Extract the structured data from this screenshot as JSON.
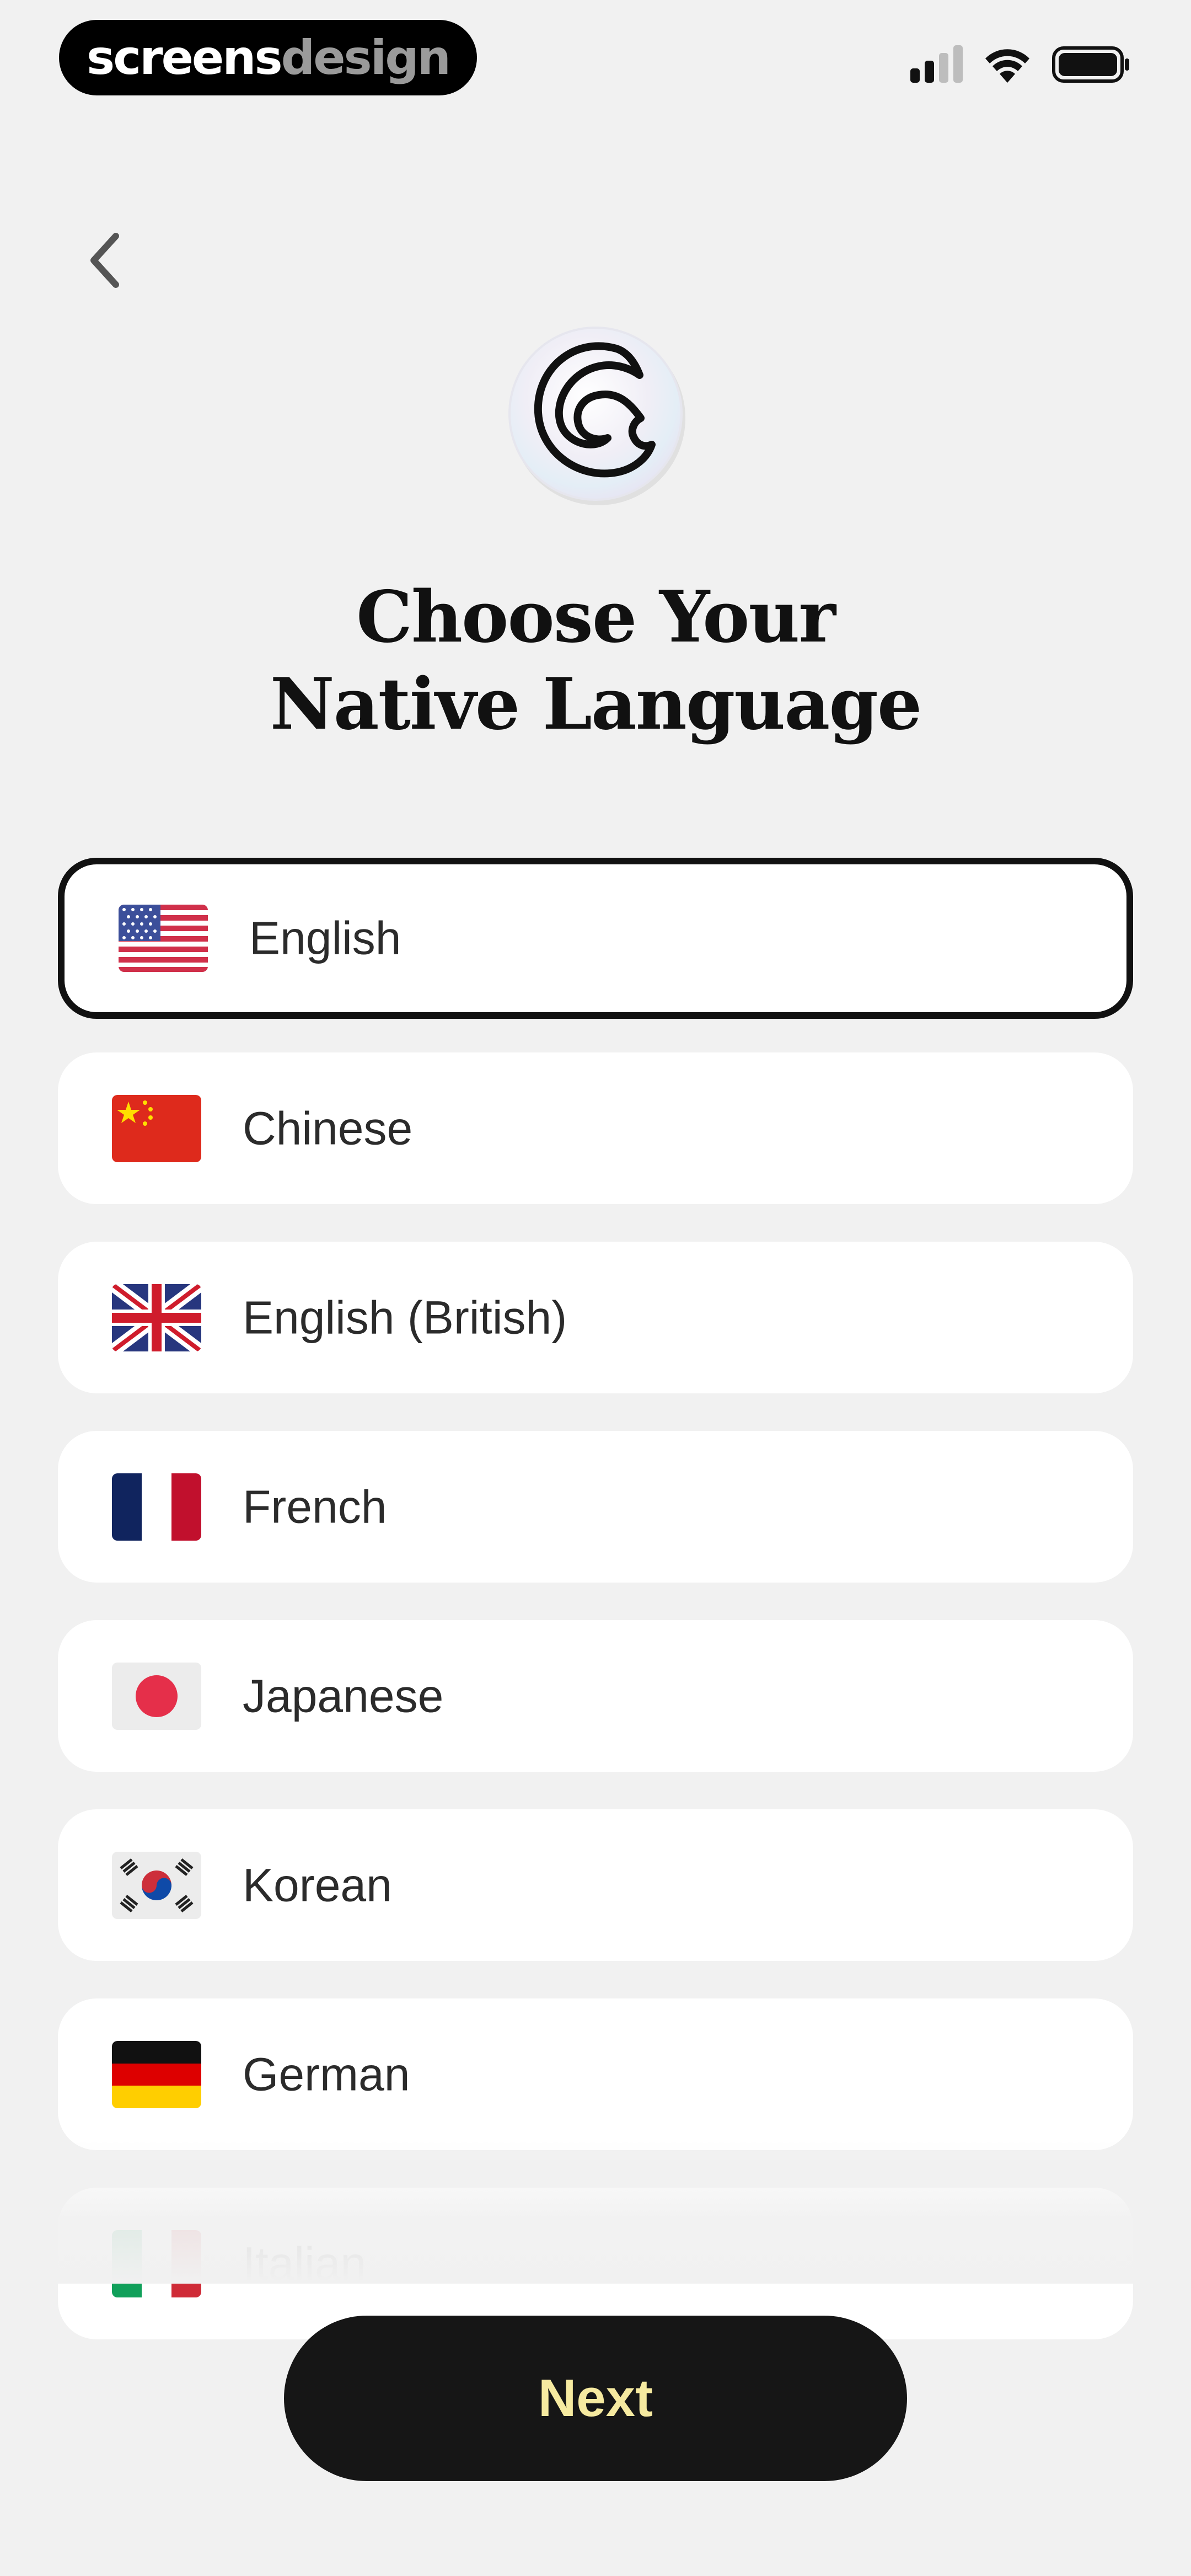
{
  "status_bar": {
    "brand_part1": "screens",
    "brand_part2": "design"
  },
  "header": {
    "back_icon": "chevron-left-icon",
    "logo_icon": "wave-logo-icon",
    "title_line1": "Choose Your",
    "title_line2": "Native Language"
  },
  "languages": [
    {
      "label": "English",
      "flag": "flag-us-icon",
      "selected": true
    },
    {
      "label": "Chinese",
      "flag": "flag-cn-icon",
      "selected": false
    },
    {
      "label": "English (British)",
      "flag": "flag-gb-icon",
      "selected": false
    },
    {
      "label": "French",
      "flag": "flag-fr-icon",
      "selected": false
    },
    {
      "label": "Japanese",
      "flag": "flag-jp-icon",
      "selected": false
    },
    {
      "label": "Korean",
      "flag": "flag-kr-icon",
      "selected": false
    },
    {
      "label": "German",
      "flag": "flag-de-icon",
      "selected": false
    },
    {
      "label": "Italian",
      "flag": "flag-it-icon",
      "selected": false
    }
  ],
  "footer": {
    "next_label": "Next"
  },
  "colors": {
    "background": "#f1f1f1",
    "card": "#ffffff",
    "selected_border": "#111111",
    "button_bg": "#161616",
    "button_text": "#f6eaa0"
  }
}
